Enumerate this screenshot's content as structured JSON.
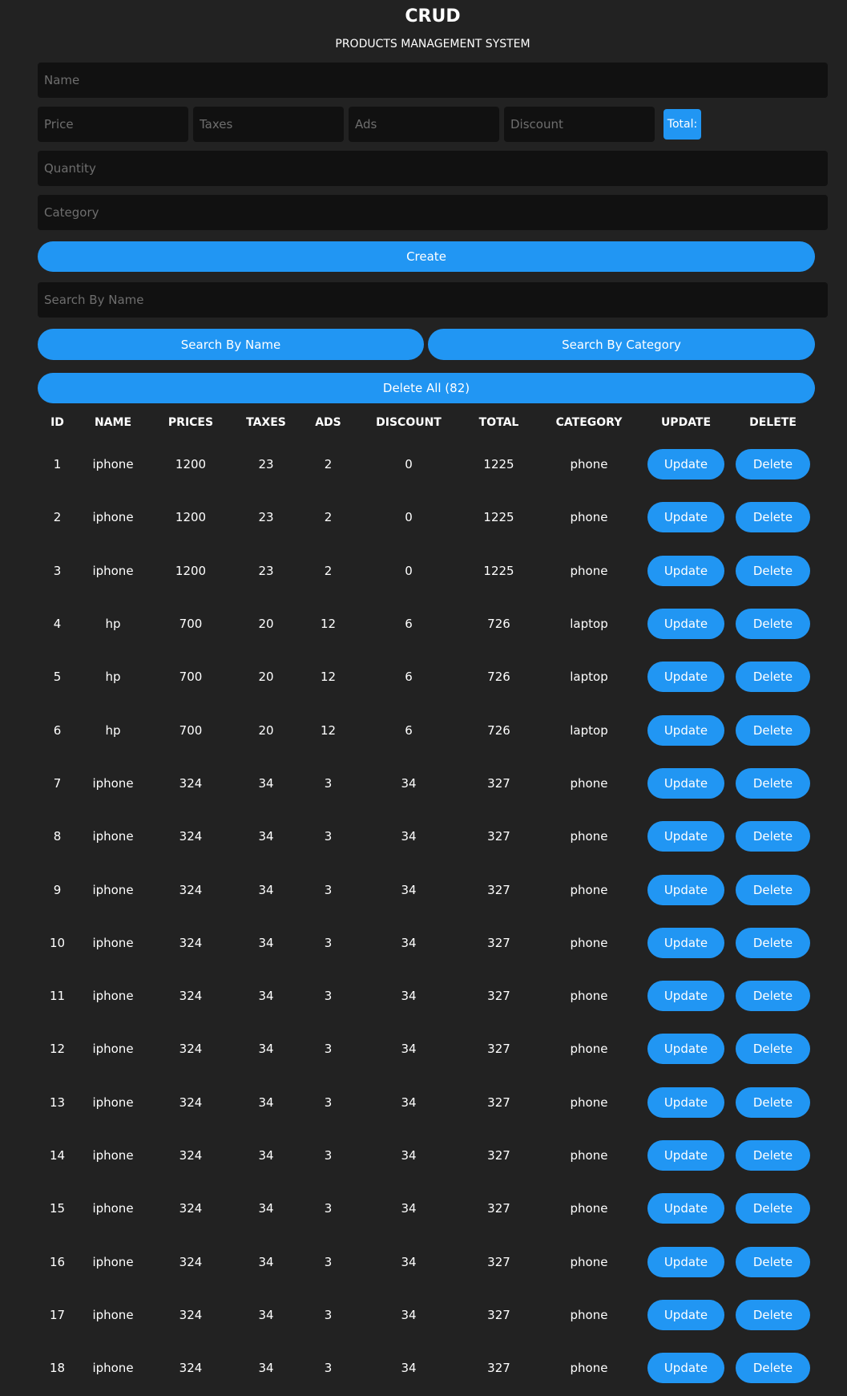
{
  "header": {
    "title": "CRUD",
    "subtitle": "PRODUCTS MANAGEMENT SYSTEM"
  },
  "form": {
    "name_placeholder": "Name",
    "price_placeholder": "Price",
    "taxes_placeholder": "Taxes",
    "ads_placeholder": "Ads",
    "discount_placeholder": "Discount",
    "total_label": "Total:",
    "quantity_placeholder": "Quantity",
    "category_placeholder": "Category",
    "create_label": "Create"
  },
  "search": {
    "placeholder": "Search By Name",
    "by_name_label": "Search By Name",
    "by_category_label": "Search By Category"
  },
  "delete_all_label": "Delete All (82)",
  "colors": {
    "background": "#222222",
    "input_background": "#111111",
    "accent": "#2196f3"
  },
  "table": {
    "headers": [
      "ID",
      "NAME",
      "PRICES",
      "TAXES",
      "ADS",
      "DISCOUNT",
      "TOTAL",
      "CATEGORY",
      "UPDATE",
      "DELETE"
    ],
    "update_label": "Update",
    "delete_label": "Delete",
    "rows": [
      {
        "id": "1",
        "name": "iphone",
        "price": "1200",
        "taxes": "23",
        "ads": "2",
        "discount": "0",
        "total": "1225",
        "category": "phone"
      },
      {
        "id": "2",
        "name": "iphone",
        "price": "1200",
        "taxes": "23",
        "ads": "2",
        "discount": "0",
        "total": "1225",
        "category": "phone"
      },
      {
        "id": "3",
        "name": "iphone",
        "price": "1200",
        "taxes": "23",
        "ads": "2",
        "discount": "0",
        "total": "1225",
        "category": "phone"
      },
      {
        "id": "4",
        "name": "hp",
        "price": "700",
        "taxes": "20",
        "ads": "12",
        "discount": "6",
        "total": "726",
        "category": "laptop"
      },
      {
        "id": "5",
        "name": "hp",
        "price": "700",
        "taxes": "20",
        "ads": "12",
        "discount": "6",
        "total": "726",
        "category": "laptop"
      },
      {
        "id": "6",
        "name": "hp",
        "price": "700",
        "taxes": "20",
        "ads": "12",
        "discount": "6",
        "total": "726",
        "category": "laptop"
      },
      {
        "id": "7",
        "name": "iphone",
        "price": "324",
        "taxes": "34",
        "ads": "3",
        "discount": "34",
        "total": "327",
        "category": "phone"
      },
      {
        "id": "8",
        "name": "iphone",
        "price": "324",
        "taxes": "34",
        "ads": "3",
        "discount": "34",
        "total": "327",
        "category": "phone"
      },
      {
        "id": "9",
        "name": "iphone",
        "price": "324",
        "taxes": "34",
        "ads": "3",
        "discount": "34",
        "total": "327",
        "category": "phone"
      },
      {
        "id": "10",
        "name": "iphone",
        "price": "324",
        "taxes": "34",
        "ads": "3",
        "discount": "34",
        "total": "327",
        "category": "phone"
      },
      {
        "id": "11",
        "name": "iphone",
        "price": "324",
        "taxes": "34",
        "ads": "3",
        "discount": "34",
        "total": "327",
        "category": "phone"
      },
      {
        "id": "12",
        "name": "iphone",
        "price": "324",
        "taxes": "34",
        "ads": "3",
        "discount": "34",
        "total": "327",
        "category": "phone"
      },
      {
        "id": "13",
        "name": "iphone",
        "price": "324",
        "taxes": "34",
        "ads": "3",
        "discount": "34",
        "total": "327",
        "category": "phone"
      },
      {
        "id": "14",
        "name": "iphone",
        "price": "324",
        "taxes": "34",
        "ads": "3",
        "discount": "34",
        "total": "327",
        "category": "phone"
      },
      {
        "id": "15",
        "name": "iphone",
        "price": "324",
        "taxes": "34",
        "ads": "3",
        "discount": "34",
        "total": "327",
        "category": "phone"
      },
      {
        "id": "16",
        "name": "iphone",
        "price": "324",
        "taxes": "34",
        "ads": "3",
        "discount": "34",
        "total": "327",
        "category": "phone"
      },
      {
        "id": "17",
        "name": "iphone",
        "price": "324",
        "taxes": "34",
        "ads": "3",
        "discount": "34",
        "total": "327",
        "category": "phone"
      },
      {
        "id": "18",
        "name": "iphone",
        "price": "324",
        "taxes": "34",
        "ads": "3",
        "discount": "34",
        "total": "327",
        "category": "phone"
      }
    ]
  }
}
